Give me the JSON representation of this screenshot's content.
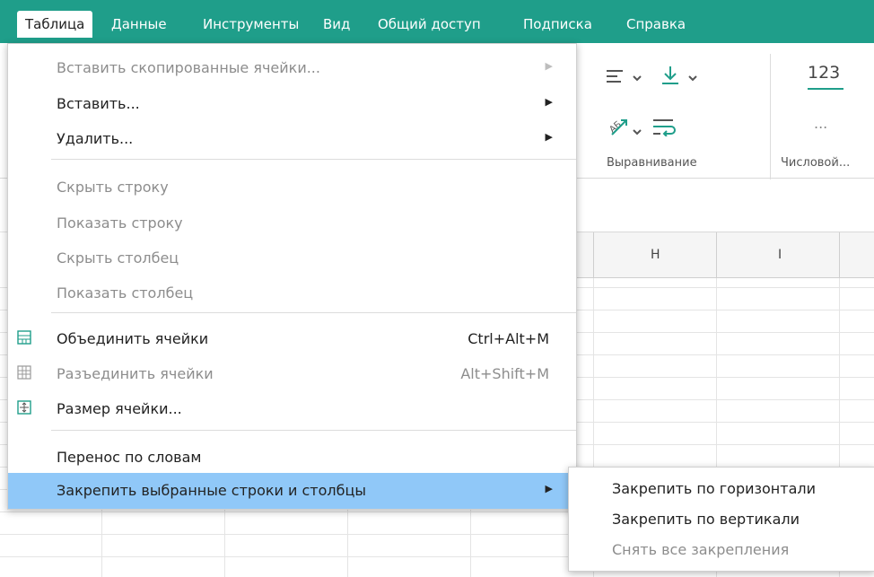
{
  "menubar": {
    "items": [
      {
        "label": "Таблица"
      },
      {
        "label": "Данные"
      },
      {
        "label": "Инструменты"
      },
      {
        "label": "Вид"
      },
      {
        "label": "Общий доступ"
      },
      {
        "label": "Подписка"
      },
      {
        "label": "Справка"
      }
    ],
    "bg_color": "#1f9e8a"
  },
  "ribbon": {
    "alignment_label": "Выравнивание",
    "number_label": "Числовой...",
    "number_format_text": "123",
    "more_text": "..."
  },
  "sheet": {
    "columns": [
      "H",
      "I"
    ]
  },
  "table_menu": {
    "items": [
      {
        "label": "Вставить скопированные ячейки..."
      },
      {
        "label": "Вставить..."
      },
      {
        "label": "Удалить..."
      },
      {
        "label": "Скрыть строку"
      },
      {
        "label": "Показать строку"
      },
      {
        "label": "Скрыть столбец"
      },
      {
        "label": "Показать столбец"
      },
      {
        "label": "Объединить ячейки",
        "shortcut": "Ctrl+Alt+M"
      },
      {
        "label": "Разъединить ячейки",
        "shortcut": "Alt+Shift+M"
      },
      {
        "label": "Размер ячейки..."
      },
      {
        "label": "Перенос по словам"
      },
      {
        "label": "Закрепить выбранные строки и столбцы"
      }
    ]
  },
  "freeze_submenu": {
    "items": [
      {
        "label": "Закрепить по горизонтали"
      },
      {
        "label": "Закрепить по вертикали"
      },
      {
        "label": "Снять все закрепления"
      }
    ]
  },
  "colors": {
    "highlight": "#90c8f8",
    "disabled": "#8d8d8d"
  }
}
